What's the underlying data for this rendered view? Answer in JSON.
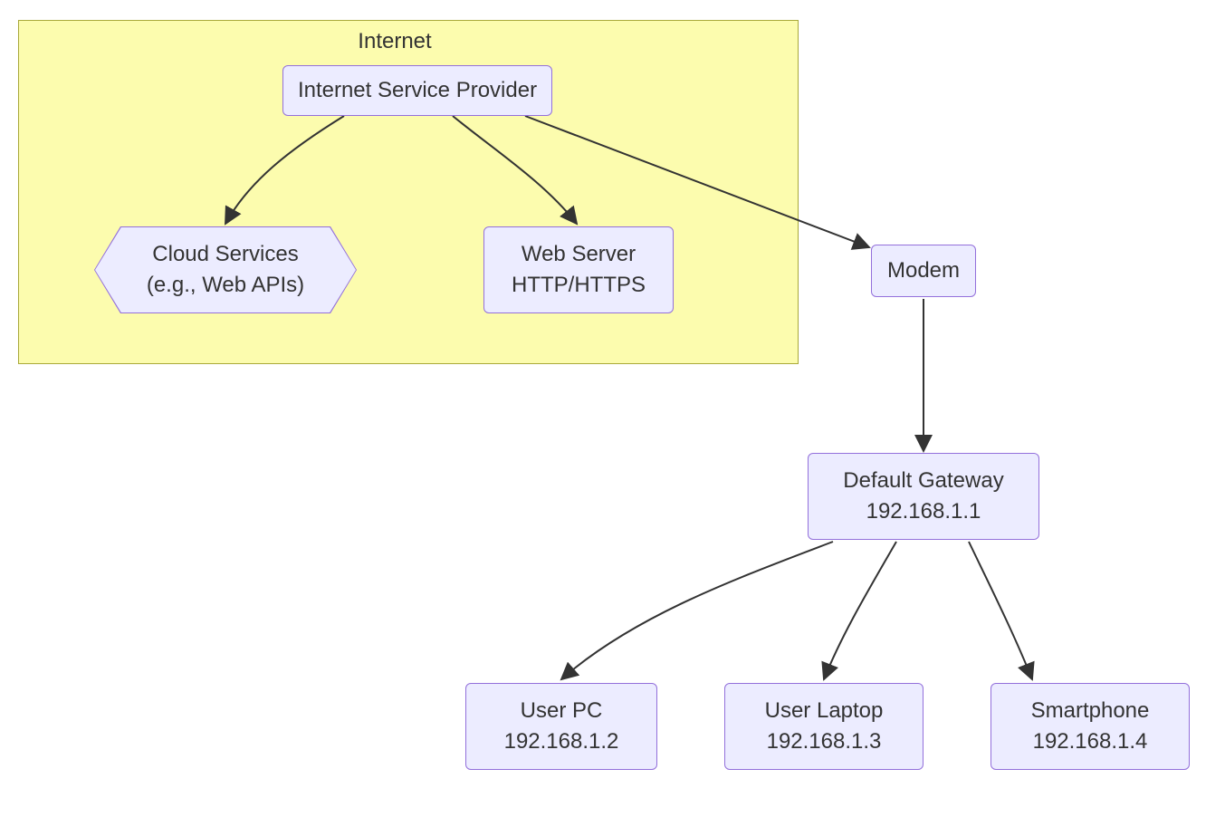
{
  "group": {
    "title": "Internet"
  },
  "nodes": {
    "isp": {
      "label": "Internet Service Provider"
    },
    "cloud": {
      "line1": "Cloud Services",
      "line2": "(e.g., Web APIs)"
    },
    "webserver": {
      "line1": "Web Server",
      "line2": "HTTP/HTTPS"
    },
    "modem": {
      "label": "Modem"
    },
    "gateway": {
      "line1": "Default Gateway",
      "line2": "192.168.1.1"
    },
    "pc": {
      "line1": "User PC",
      "line2": "192.168.1.2"
    },
    "laptop": {
      "line1": "User Laptop",
      "line2": "192.168.1.3"
    },
    "phone": {
      "line1": "Smartphone",
      "line2": "192.168.1.4"
    }
  },
  "edges": [
    {
      "from": "isp",
      "to": "cloud"
    },
    {
      "from": "isp",
      "to": "webserver"
    },
    {
      "from": "isp",
      "to": "modem"
    },
    {
      "from": "modem",
      "to": "gateway"
    },
    {
      "from": "gateway",
      "to": "pc"
    },
    {
      "from": "gateway",
      "to": "laptop"
    },
    {
      "from": "gateway",
      "to": "phone"
    }
  ],
  "colors": {
    "nodeFill": "#ececff",
    "nodeStroke": "#9370db",
    "groupFill": "#fcfcae",
    "groupStroke": "#a9a93a",
    "edge": "#333333"
  }
}
